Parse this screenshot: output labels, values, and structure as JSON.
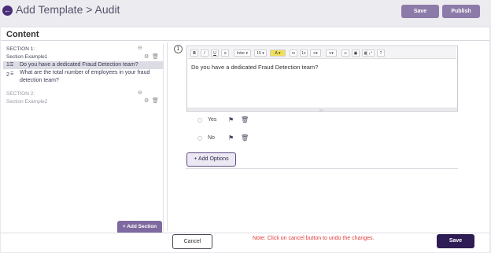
{
  "header": {
    "title": "Add Template > Audit",
    "save_label": "Save",
    "publish_label": "Publish"
  },
  "content_title": "Content",
  "sidebar": {
    "sections": [
      {
        "label": "SECTION 1:",
        "name": "Section Example1",
        "questions": [
          {
            "num": "1",
            "text": "Do you have a dedicated Fraud Detection team?"
          },
          {
            "num": "2",
            "text_line1": "What are the total number of employees in your fraud",
            "text_line2": "detection team?"
          }
        ]
      },
      {
        "label": "SECTION 2:",
        "name": "Section Example2"
      }
    ],
    "add_section_label": "+ Add Section"
  },
  "editor": {
    "question_number": "1",
    "toolbar": {
      "bold": "B",
      "italic": "I",
      "underline": "U",
      "font": "Inter ▾",
      "size": "15 ▾",
      "color": "A ▾",
      "help": "?"
    },
    "text": "Do you have a dedicated Fraud Detection team?"
  },
  "options": [
    {
      "label": "Yes"
    },
    {
      "label": "No"
    }
  ],
  "add_options_label": "+ Add Options",
  "footer": {
    "cancel_label": "Cancel",
    "note": "Note: Click on cancel button to undo the changes.",
    "save_label": "Save"
  }
}
